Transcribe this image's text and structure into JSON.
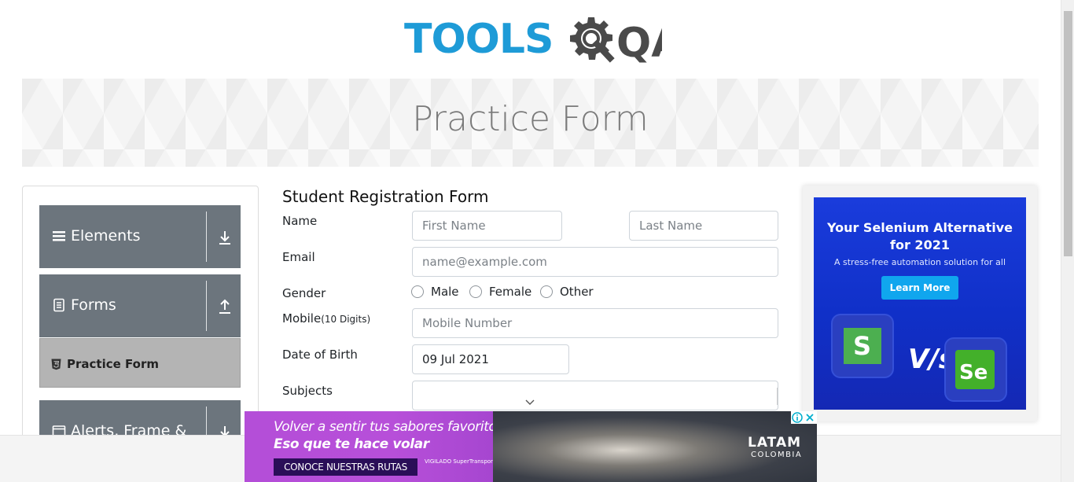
{
  "logo": {
    "text_part": "TOOLS",
    "suffix": "QA"
  },
  "banner": {
    "title": "Practice Form"
  },
  "sidebar": {
    "groups": [
      {
        "label": "Elements",
        "icon": "hamburger-icon",
        "arrow": "download-arrow-icon"
      },
      {
        "label": "Forms",
        "icon": "document-icon",
        "arrow": "upload-arrow-icon"
      },
      {
        "label": "Alerts, Frame &",
        "icon": "window-icon",
        "arrow": "download-arrow-icon"
      }
    ],
    "active_item": {
      "label": "Practice Form",
      "icon": "html5-icon"
    }
  },
  "form": {
    "title": "Student Registration Form",
    "labels": {
      "name": "Name",
      "email": "Email",
      "gender": "Gender",
      "mobile": "Mobile",
      "mobile_hint": "(10 Digits)",
      "dob": "Date of Birth",
      "subjects": "Subjects"
    },
    "placeholders": {
      "first_name": "First Name",
      "last_name": "Last Name",
      "email": "name@example.com",
      "mobile": "Mobile Number"
    },
    "values": {
      "dob": "09 Jul 2021"
    },
    "gender_options": [
      "Male",
      "Female",
      "Other"
    ]
  },
  "ad_right": {
    "title_line1": "Your Selenium Alternative",
    "title_line2": "for 2021",
    "subtitle": "A stress-free automation solution for all",
    "button": "Learn More",
    "vs": "V/s",
    "left_logo": "S",
    "right_logo": "Se"
  },
  "ad_bottom": {
    "line1": "Volver a sentir tus sabores favoritos",
    "line2": "Eso que te hace volar",
    "cta": "CONOCE NUESTRAS RUTAS",
    "brand": "LATAM",
    "brand_sub": "COLOMBIA",
    "badge": "VIGILADO SuperTransporte"
  },
  "colors": {
    "brand_blue": "#1e9bd7",
    "sidebar_gray": "#6c757d",
    "active_gray": "#b4b4b4"
  }
}
